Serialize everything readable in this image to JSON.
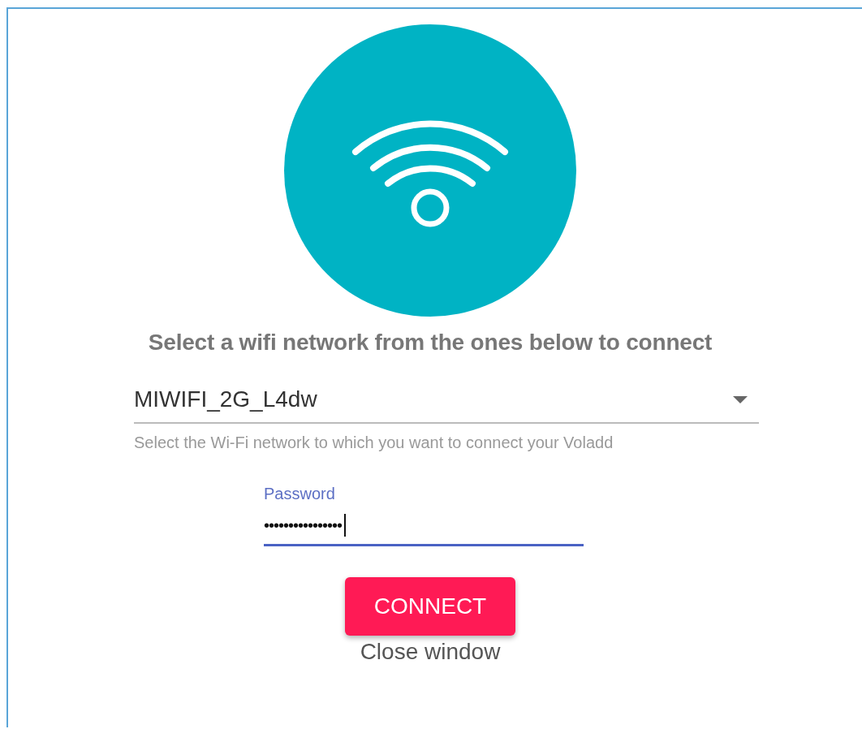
{
  "heading": "Select a wifi network from the ones below to connect",
  "network_select": {
    "value": "MIWIFI_2G_L4dw",
    "helper": "Select the Wi-Fi network to which you want to connect your Voladd"
  },
  "password": {
    "label": "Password",
    "value": "••••••••••••••••",
    "focused": true
  },
  "connect_button": "CONNECT",
  "close_link": "Close window"
}
